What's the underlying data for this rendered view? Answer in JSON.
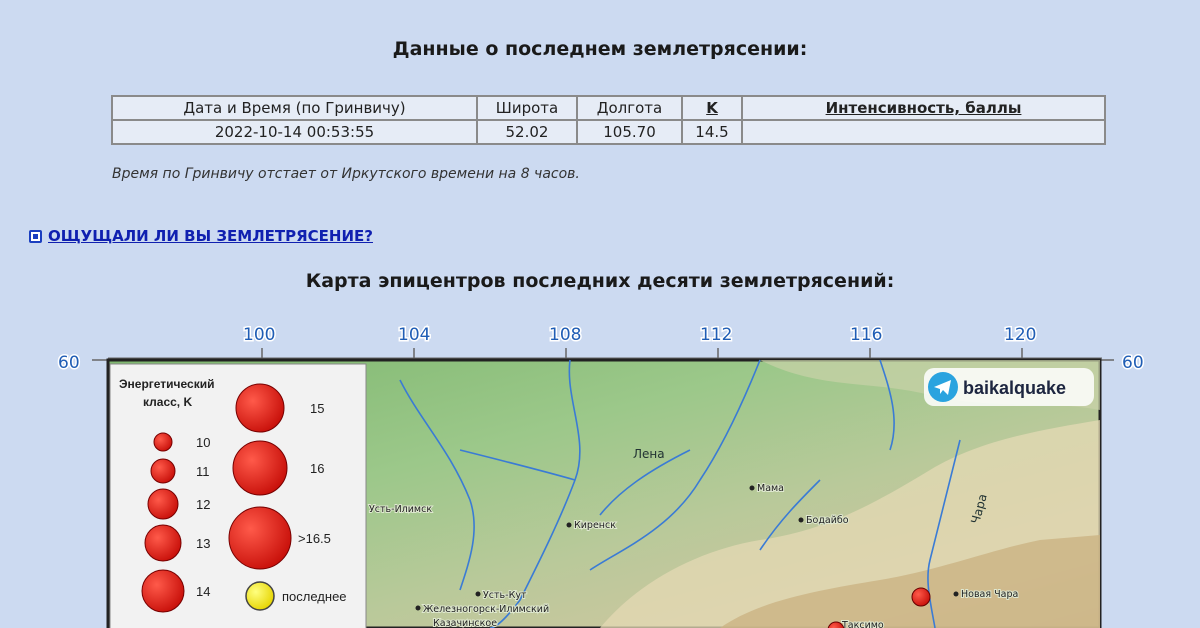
{
  "header": {
    "title": "Данные о последнем землетрясении:"
  },
  "table": {
    "columns": [
      "Дата и Время (по Гринвичу)",
      "Широта",
      "Долгота",
      "K",
      "Интенсивность, баллы"
    ],
    "row": [
      "2022-10-14 00:53:55",
      "52.02",
      "105.70",
      "14.5",
      ""
    ]
  },
  "note": "Время по Гринвичу отстает от Иркутского времени на 8 часов.",
  "felt_link": "ОЩУЩАЛИ ЛИ ВЫ ЗЕМЛЕТРЯСЕНИЕ?",
  "map": {
    "title": "Карта эпицентров последних десяти землетрясений:",
    "longitudes": [
      "100",
      "104",
      "108",
      "112",
      "116",
      "120"
    ],
    "latitude_label": "60",
    "brand": "baikalquake",
    "legend": {
      "header_line1": "Энергетический",
      "header_line2": "класс, K",
      "items": [
        "10",
        "11",
        "12",
        "13",
        "14",
        "15",
        "16",
        ">16.5",
        "последнее"
      ]
    },
    "places": {
      "river_lena": "Лена",
      "river_chara": "Чара",
      "mama": "Мама",
      "bodaibo": "Бодайбо",
      "ust_ilimsk": "Усть-Илимск",
      "kirensk": "Киренск",
      "ust_kut": "Усть-Кут",
      "zheleznogorsk": "Железногорск-Илимский",
      "kazachinskoe": "Казачинское",
      "novaya_chara": "Новая Чара",
      "taksimo": "Таксимо"
    }
  }
}
